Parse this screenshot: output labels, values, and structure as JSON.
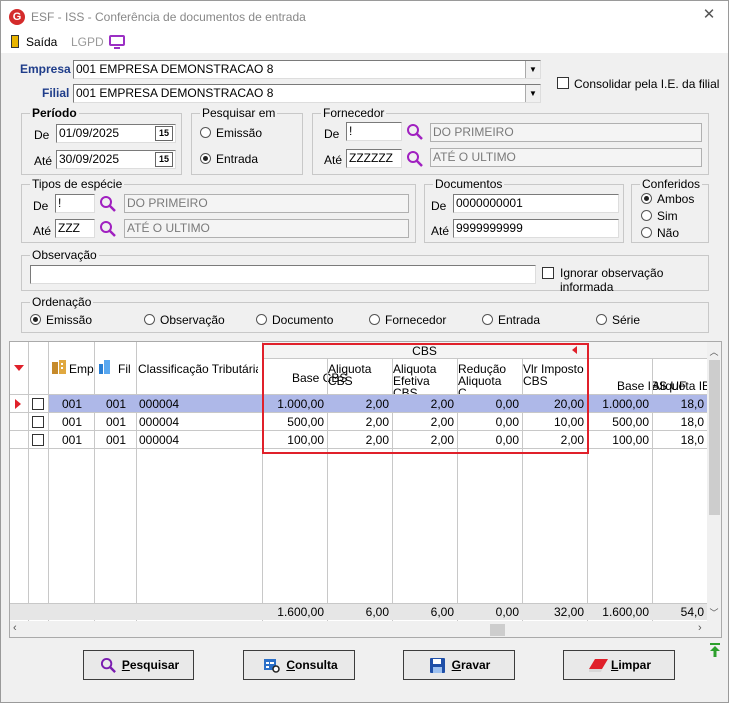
{
  "window": {
    "title": "ESF - ISS - Conferência de documentos de entrada",
    "logo_letter": "G"
  },
  "menu": {
    "exit": "Saída",
    "lgpd": "LGPD"
  },
  "empresa": {
    "label": "Empresa",
    "value": "001 EMPRESA DEMONSTRACAO 8"
  },
  "filial": {
    "label": "Filial",
    "value": "001 EMPRESA DEMONSTRACAO 8"
  },
  "consolidar": {
    "label": "Consolidar pela I.E. da filial"
  },
  "periodo": {
    "legend": "Período",
    "de_label": "De",
    "de_value": "01/09/2025",
    "ate_label": "Até",
    "ate_value": "30/09/2025",
    "cal": "15"
  },
  "pesquisar": {
    "legend": "Pesquisar em",
    "opt1": "Emissão",
    "opt2": "Entrada"
  },
  "fornecedor": {
    "legend": "Fornecedor",
    "de_label": "De",
    "de_code": "!",
    "de_name": "DO PRIMEIRO",
    "ate_label": "Até",
    "ate_code": "ZZZZZZ",
    "ate_name": "ATÉ O ULTIMO"
  },
  "tipos": {
    "legend": "Tipos de espécie",
    "de_label": "De",
    "de_code": "!",
    "de_name": "DO PRIMEIRO",
    "ate_label": "Até",
    "ate_code": "ZZZ",
    "ate_name": "ATÉ O ULTIMO"
  },
  "documentos": {
    "legend": "Documentos",
    "de_label": "De",
    "de_value": "0000000001",
    "ate_label": "Até",
    "ate_value": "9999999999"
  },
  "conferidos": {
    "legend": "Conferidos",
    "opt1": "Ambos",
    "opt2": "Sim",
    "opt3": "Não"
  },
  "observacao": {
    "legend": "Observação",
    "value": "",
    "ignore_label": "Ignorar observação informada"
  },
  "ordenacao": {
    "legend": "Ordenação",
    "opts": [
      "Emissão",
      "Observação",
      "Documento",
      "Fornecedor",
      "Entrada",
      "Série"
    ]
  },
  "grid": {
    "group_header": "CBS",
    "headers": {
      "emp": "Emp",
      "fil": "Fil",
      "classif": "Classificação Tributária",
      "base_cbs": "Base CBS",
      "aliq_cbs": "Aliquota CBS",
      "aliq_ef": "Aliquota Efetiva CBS",
      "reducao": "Redução Aliquota C...",
      "vlr_imp": "Vlr Imposto CBS",
      "base_ibs": "Base IBS UF",
      "aliq_ibs": "Aliquota IB..."
    },
    "rows": [
      {
        "emp": "001",
        "fil": "001",
        "classif": "000004",
        "base_cbs": "1.000,00",
        "aliq_cbs": "2,00",
        "aliq_ef": "2,00",
        "reducao": "0,00",
        "vlr_imp": "20,00",
        "base_ibs": "1.000,00",
        "aliq_ibs": "18,0"
      },
      {
        "emp": "001",
        "fil": "001",
        "classif": "000004",
        "base_cbs": "500,00",
        "aliq_cbs": "2,00",
        "aliq_ef": "2,00",
        "reducao": "0,00",
        "vlr_imp": "10,00",
        "base_ibs": "500,00",
        "aliq_ibs": "18,0"
      },
      {
        "emp": "001",
        "fil": "001",
        "classif": "000004",
        "base_cbs": "100,00",
        "aliq_cbs": "2,00",
        "aliq_ef": "2,00",
        "reducao": "0,00",
        "vlr_imp": "2,00",
        "base_ibs": "100,00",
        "aliq_ibs": "18,0"
      }
    ],
    "totals": {
      "base_cbs": "1.600,00",
      "aliq_cbs": "6,00",
      "aliq_ef": "6,00",
      "reducao": "0,00",
      "vlr_imp": "32,00",
      "base_ibs": "1.600,00",
      "aliq_ibs": "54,0"
    }
  },
  "buttons": {
    "pesquisar_u": "P",
    "pesquisar_rest": "esquisar",
    "consulta_u": "C",
    "consulta_rest": "onsulta",
    "gravar_u": "G",
    "gravar_rest": "ravar",
    "limpar_u": "L",
    "limpar_rest": "impar"
  },
  "colors": {
    "accent_red": "#e0202a",
    "selected_row": "#aeb8e8",
    "label_blue": "#1f3d8a",
    "lgpd_purple": "#9b2fc4"
  }
}
